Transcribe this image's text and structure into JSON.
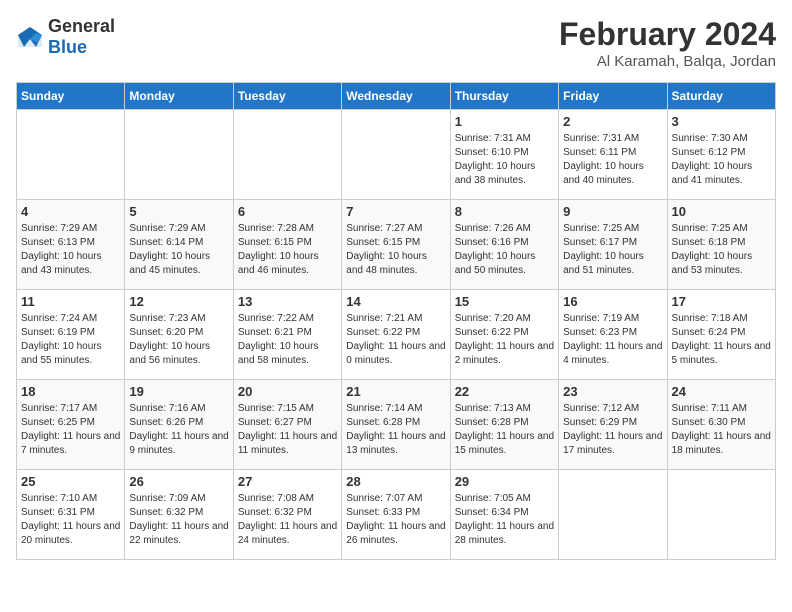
{
  "logo": {
    "general": "General",
    "blue": "Blue"
  },
  "header": {
    "month_year": "February 2024",
    "location": "Al Karamah, Balqa, Jordan"
  },
  "days_of_week": [
    "Sunday",
    "Monday",
    "Tuesday",
    "Wednesday",
    "Thursday",
    "Friday",
    "Saturday"
  ],
  "weeks": [
    [
      {
        "day": "",
        "sunrise": "",
        "sunset": "",
        "daylight": ""
      },
      {
        "day": "",
        "sunrise": "",
        "sunset": "",
        "daylight": ""
      },
      {
        "day": "",
        "sunrise": "",
        "sunset": "",
        "daylight": ""
      },
      {
        "day": "",
        "sunrise": "",
        "sunset": "",
        "daylight": ""
      },
      {
        "day": "1",
        "sunrise": "Sunrise: 7:31 AM",
        "sunset": "Sunset: 6:10 PM",
        "daylight": "Daylight: 10 hours and 38 minutes."
      },
      {
        "day": "2",
        "sunrise": "Sunrise: 7:31 AM",
        "sunset": "Sunset: 6:11 PM",
        "daylight": "Daylight: 10 hours and 40 minutes."
      },
      {
        "day": "3",
        "sunrise": "Sunrise: 7:30 AM",
        "sunset": "Sunset: 6:12 PM",
        "daylight": "Daylight: 10 hours and 41 minutes."
      }
    ],
    [
      {
        "day": "4",
        "sunrise": "Sunrise: 7:29 AM",
        "sunset": "Sunset: 6:13 PM",
        "daylight": "Daylight: 10 hours and 43 minutes."
      },
      {
        "day": "5",
        "sunrise": "Sunrise: 7:29 AM",
        "sunset": "Sunset: 6:14 PM",
        "daylight": "Daylight: 10 hours and 45 minutes."
      },
      {
        "day": "6",
        "sunrise": "Sunrise: 7:28 AM",
        "sunset": "Sunset: 6:15 PM",
        "daylight": "Daylight: 10 hours and 46 minutes."
      },
      {
        "day": "7",
        "sunrise": "Sunrise: 7:27 AM",
        "sunset": "Sunset: 6:15 PM",
        "daylight": "Daylight: 10 hours and 48 minutes."
      },
      {
        "day": "8",
        "sunrise": "Sunrise: 7:26 AM",
        "sunset": "Sunset: 6:16 PM",
        "daylight": "Daylight: 10 hours and 50 minutes."
      },
      {
        "day": "9",
        "sunrise": "Sunrise: 7:25 AM",
        "sunset": "Sunset: 6:17 PM",
        "daylight": "Daylight: 10 hours and 51 minutes."
      },
      {
        "day": "10",
        "sunrise": "Sunrise: 7:25 AM",
        "sunset": "Sunset: 6:18 PM",
        "daylight": "Daylight: 10 hours and 53 minutes."
      }
    ],
    [
      {
        "day": "11",
        "sunrise": "Sunrise: 7:24 AM",
        "sunset": "Sunset: 6:19 PM",
        "daylight": "Daylight: 10 hours and 55 minutes."
      },
      {
        "day": "12",
        "sunrise": "Sunrise: 7:23 AM",
        "sunset": "Sunset: 6:20 PM",
        "daylight": "Daylight: 10 hours and 56 minutes."
      },
      {
        "day": "13",
        "sunrise": "Sunrise: 7:22 AM",
        "sunset": "Sunset: 6:21 PM",
        "daylight": "Daylight: 10 hours and 58 minutes."
      },
      {
        "day": "14",
        "sunrise": "Sunrise: 7:21 AM",
        "sunset": "Sunset: 6:22 PM",
        "daylight": "Daylight: 11 hours and 0 minutes."
      },
      {
        "day": "15",
        "sunrise": "Sunrise: 7:20 AM",
        "sunset": "Sunset: 6:22 PM",
        "daylight": "Daylight: 11 hours and 2 minutes."
      },
      {
        "day": "16",
        "sunrise": "Sunrise: 7:19 AM",
        "sunset": "Sunset: 6:23 PM",
        "daylight": "Daylight: 11 hours and 4 minutes."
      },
      {
        "day": "17",
        "sunrise": "Sunrise: 7:18 AM",
        "sunset": "Sunset: 6:24 PM",
        "daylight": "Daylight: 11 hours and 5 minutes."
      }
    ],
    [
      {
        "day": "18",
        "sunrise": "Sunrise: 7:17 AM",
        "sunset": "Sunset: 6:25 PM",
        "daylight": "Daylight: 11 hours and 7 minutes."
      },
      {
        "day": "19",
        "sunrise": "Sunrise: 7:16 AM",
        "sunset": "Sunset: 6:26 PM",
        "daylight": "Daylight: 11 hours and 9 minutes."
      },
      {
        "day": "20",
        "sunrise": "Sunrise: 7:15 AM",
        "sunset": "Sunset: 6:27 PM",
        "daylight": "Daylight: 11 hours and 11 minutes."
      },
      {
        "day": "21",
        "sunrise": "Sunrise: 7:14 AM",
        "sunset": "Sunset: 6:28 PM",
        "daylight": "Daylight: 11 hours and 13 minutes."
      },
      {
        "day": "22",
        "sunrise": "Sunrise: 7:13 AM",
        "sunset": "Sunset: 6:28 PM",
        "daylight": "Daylight: 11 hours and 15 minutes."
      },
      {
        "day": "23",
        "sunrise": "Sunrise: 7:12 AM",
        "sunset": "Sunset: 6:29 PM",
        "daylight": "Daylight: 11 hours and 17 minutes."
      },
      {
        "day": "24",
        "sunrise": "Sunrise: 7:11 AM",
        "sunset": "Sunset: 6:30 PM",
        "daylight": "Daylight: 11 hours and 18 minutes."
      }
    ],
    [
      {
        "day": "25",
        "sunrise": "Sunrise: 7:10 AM",
        "sunset": "Sunset: 6:31 PM",
        "daylight": "Daylight: 11 hours and 20 minutes."
      },
      {
        "day": "26",
        "sunrise": "Sunrise: 7:09 AM",
        "sunset": "Sunset: 6:32 PM",
        "daylight": "Daylight: 11 hours and 22 minutes."
      },
      {
        "day": "27",
        "sunrise": "Sunrise: 7:08 AM",
        "sunset": "Sunset: 6:32 PM",
        "daylight": "Daylight: 11 hours and 24 minutes."
      },
      {
        "day": "28",
        "sunrise": "Sunrise: 7:07 AM",
        "sunset": "Sunset: 6:33 PM",
        "daylight": "Daylight: 11 hours and 26 minutes."
      },
      {
        "day": "29",
        "sunrise": "Sunrise: 7:05 AM",
        "sunset": "Sunset: 6:34 PM",
        "daylight": "Daylight: 11 hours and 28 minutes."
      },
      {
        "day": "",
        "sunrise": "",
        "sunset": "",
        "daylight": ""
      },
      {
        "day": "",
        "sunrise": "",
        "sunset": "",
        "daylight": ""
      }
    ]
  ]
}
